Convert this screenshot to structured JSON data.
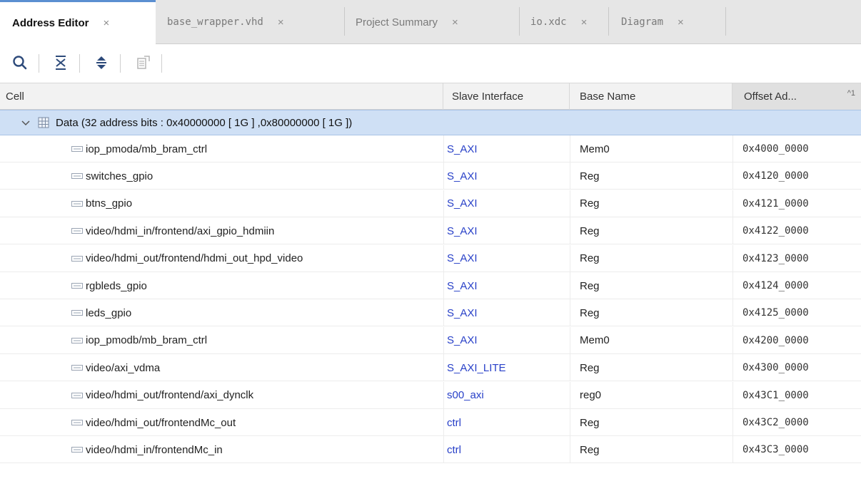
{
  "tabs": [
    {
      "label": "Address Editor",
      "active": true
    },
    {
      "label": "base_wrapper.vhd",
      "active": false
    },
    {
      "label": "Project Summary",
      "active": false
    },
    {
      "label": "io.xdc",
      "active": false
    },
    {
      "label": "Diagram",
      "active": false
    }
  ],
  "tab_close_glyph": "×",
  "toolbar": {
    "icons": [
      "search-icon",
      "collapse-all-icon",
      "expand-all-icon",
      "auto-assign-address-icon"
    ]
  },
  "table": {
    "columns": [
      "Cell",
      "Slave Interface",
      "Base Name",
      "Offset Ad..."
    ],
    "sort_indicator": "^1",
    "group": {
      "label": "Data (32 address bits : 0x40000000 [ 1G ] ,0x80000000 [ 1G ])",
      "expanded": true
    },
    "rows": [
      {
        "cell": "iop_pmoda/mb_bram_ctrl",
        "slave_interface": "S_AXI",
        "base_name": "Mem0",
        "offset": "0x4000_0000"
      },
      {
        "cell": "switches_gpio",
        "slave_interface": "S_AXI",
        "base_name": "Reg",
        "offset": "0x4120_0000"
      },
      {
        "cell": "btns_gpio",
        "slave_interface": "S_AXI",
        "base_name": "Reg",
        "offset": "0x4121_0000"
      },
      {
        "cell": "video/hdmi_in/frontend/axi_gpio_hdmiin",
        "slave_interface": "S_AXI",
        "base_name": "Reg",
        "offset": "0x4122_0000"
      },
      {
        "cell": "video/hdmi_out/frontend/hdmi_out_hpd_video",
        "slave_interface": "S_AXI",
        "base_name": "Reg",
        "offset": "0x4123_0000"
      },
      {
        "cell": "rgbleds_gpio",
        "slave_interface": "S_AXI",
        "base_name": "Reg",
        "offset": "0x4124_0000"
      },
      {
        "cell": "leds_gpio",
        "slave_interface": "S_AXI",
        "base_name": "Reg",
        "offset": "0x4125_0000"
      },
      {
        "cell": "iop_pmodb/mb_bram_ctrl",
        "slave_interface": "S_AXI",
        "base_name": "Mem0",
        "offset": "0x4200_0000"
      },
      {
        "cell": "video/axi_vdma",
        "slave_interface": "S_AXI_LITE",
        "base_name": "Reg",
        "offset": "0x4300_0000"
      },
      {
        "cell": "video/hdmi_out/frontend/axi_dynclk",
        "slave_interface": "s00_axi",
        "base_name": "reg0",
        "offset": "0x43C1_0000"
      },
      {
        "cell": "video/hdmi_out/frontendMc_out",
        "slave_interface": "ctrl",
        "base_name": "Reg",
        "offset": "0x43C2_0000"
      },
      {
        "cell": "video/hdmi_in/frontendMc_in",
        "slave_interface": "ctrl",
        "base_name": "Reg",
        "offset": "0x43C3_0000"
      }
    ]
  },
  "colors": {
    "tab_accent": "#5b8fd1",
    "group_row_bg": "#cfe0f5",
    "slave_interface_link": "#2840c8"
  }
}
